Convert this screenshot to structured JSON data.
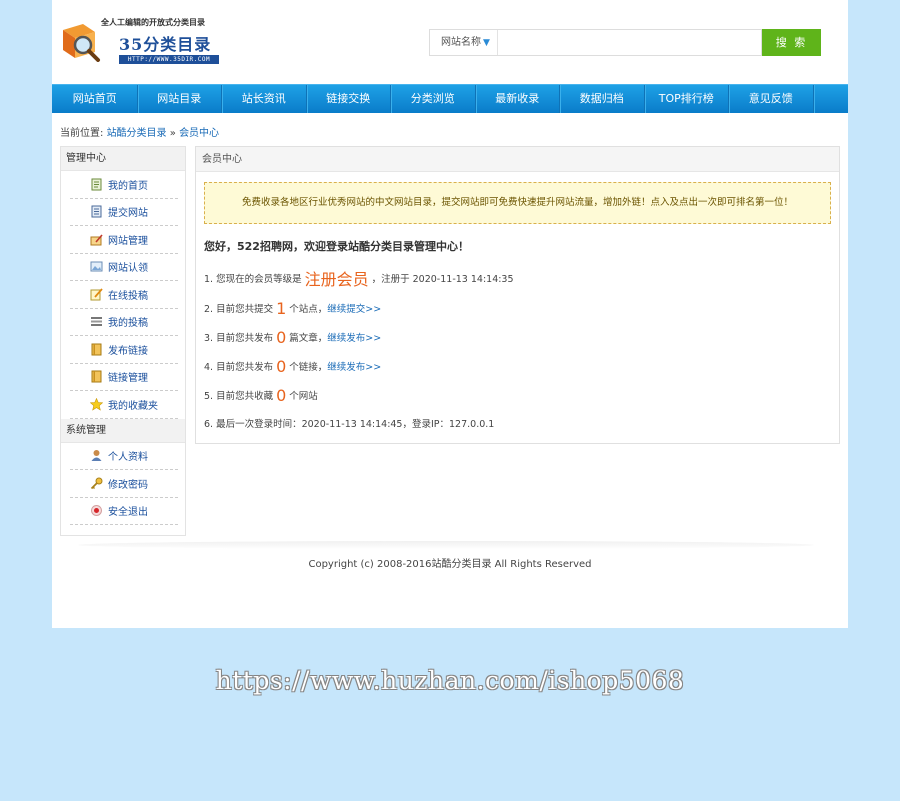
{
  "header": {
    "logo_tagline": "全人工编辑的开放式分类目录",
    "logo_name": "35分类目录",
    "logo_url": "HTTP://WWW.35DIR.COM",
    "search_type": "网站名称",
    "search_value": "",
    "search_button": "搜 索"
  },
  "nav": [
    "网站首页",
    "网站目录",
    "站长资讯",
    "链接交换",
    "分类浏览",
    "最新收录",
    "数据归档",
    "TOP排行榜",
    "意见反馈"
  ],
  "breadcrumb": {
    "prefix": "当前位置:",
    "home": "站酷分类目录",
    "separator": "»",
    "current": "会员中心"
  },
  "sidebar": {
    "section1_title": "管理中心",
    "section1_items": [
      {
        "label": "我的首页",
        "icon": "home-doc-icon"
      },
      {
        "label": "提交网站",
        "icon": "submit-doc-icon"
      },
      {
        "label": "网站管理",
        "icon": "folder-pen-icon"
      },
      {
        "label": "网站认领",
        "icon": "image-icon"
      },
      {
        "label": "在线投稿",
        "icon": "note-pen-icon"
      },
      {
        "label": "我的投稿",
        "icon": "list-icon"
      },
      {
        "label": "发布链接",
        "icon": "book-icon"
      },
      {
        "label": "链接管理",
        "icon": "book-icon"
      },
      {
        "label": "我的收藏夹",
        "icon": "star-icon"
      }
    ],
    "section2_title": "系统管理",
    "section2_items": [
      {
        "label": "个人资料",
        "icon": "user-icon"
      },
      {
        "label": "修改密码",
        "icon": "key-icon"
      },
      {
        "label": "安全退出",
        "icon": "logout-icon"
      }
    ]
  },
  "main": {
    "title": "会员中心",
    "notice": "免费收录各地区行业优秀网站的中文网站目录，提交网站即可免费快速提升网站流量，增加外链！点入及点出一次即可排名第一位！",
    "welcome": "您好，522招聘网，欢迎登录站酷分类目录管理中心！",
    "line1_prefix": "1. 您现在的会员等级是",
    "line1_level": "注册会员",
    "line1_suffix": "，注册于 2020-11-13 14:14:35",
    "line2_prefix": "2. 目前您共提交",
    "line2_count": "1",
    "line2_suffix": "个站点，",
    "line2_link": "继续提交>>",
    "line3_prefix": "3. 目前您共发布",
    "line3_count": "0",
    "line3_suffix": "篇文章，",
    "line3_link": "继续发布>>",
    "line4_prefix": "4. 目前您共发布",
    "line4_count": "0",
    "line4_suffix": "个链接，",
    "line4_link": "继续发布>>",
    "line5_prefix": "5. 目前您共收藏",
    "line5_count": "0",
    "line5_suffix": "个网站",
    "line6": "6. 最后一次登录时间：2020-11-13 14:14:45，登录IP：127.0.0.1"
  },
  "footer": {
    "copyright": "Copyright (c) 2008-2016站酷分类目录 All Rights Reserved"
  },
  "watermark": "https://www.huzhan.com/ishop5068",
  "colors": {
    "accent": "#0a7cc9",
    "highlight": "#e8641e",
    "search_button": "#5fb41a",
    "page_bg": "#c6e6fb"
  }
}
